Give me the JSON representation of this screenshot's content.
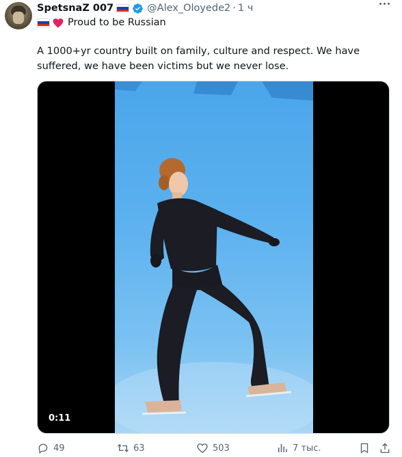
{
  "author": {
    "display_name": "SpetsnaZ 007",
    "handle": "@Alex_Oloyede2",
    "separator": "·",
    "time": "1 ч",
    "verified": true,
    "flag": "russian-flag",
    "bio": "Proud to be Russian"
  },
  "tweet": {
    "text": "A 1000+yr country built on family, culture and respect. We have suffered, we have been victims but we never lose."
  },
  "media": {
    "type": "video",
    "duration": "0:11"
  },
  "actions": {
    "replies": "49",
    "reposts": "63",
    "likes": "503",
    "views": "7 тыс."
  },
  "colors": {
    "text": "#0f1419",
    "secondary": "#536471",
    "verified": "#1d9bf0",
    "ice": "#5cb1ef"
  }
}
